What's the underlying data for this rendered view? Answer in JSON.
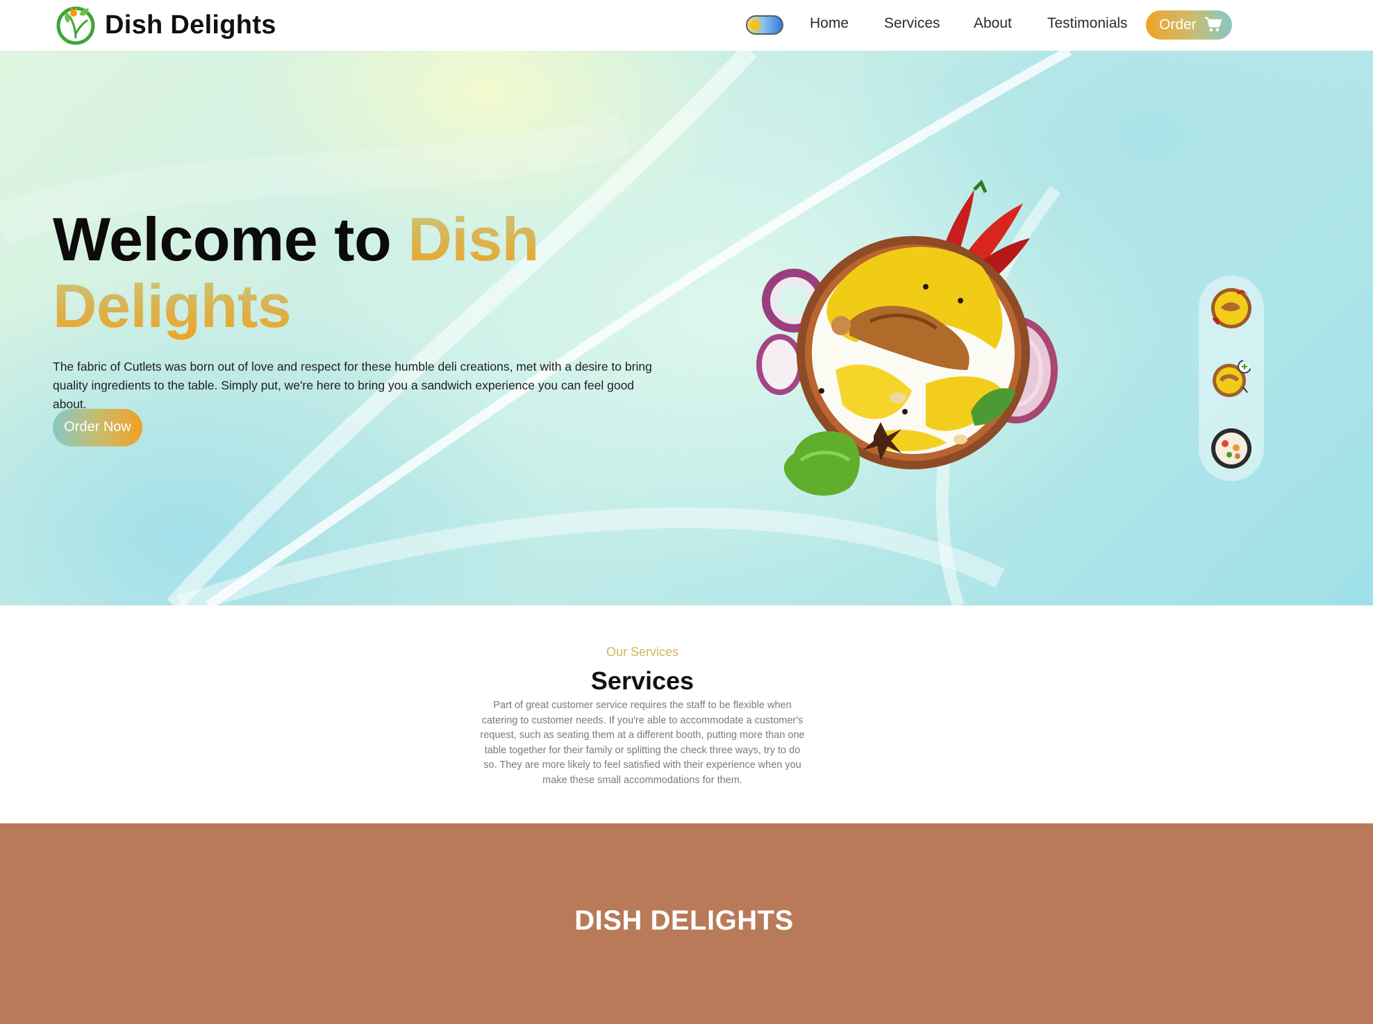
{
  "header": {
    "brand": "Dish Delights",
    "nav": [
      "Home",
      "Services",
      "About",
      "Testimonials"
    ],
    "order_label": "Order"
  },
  "hero": {
    "title_plain": "Welcome to ",
    "title_accent_line1": "Dish",
    "title_accent_line2": "Delights",
    "description": "The fabric of Cutlets was born out of love and respect for these humble deli creations, met with a desire to bring quality ingredients to the table. Simply put, we're here to bring you a sandwich experience you can feel good about.",
    "cta": "Order Now",
    "thumbnails": [
      "biryani-bowl-thumb",
      "biryani-plate-thumb",
      "rice-bowl-thumb"
    ]
  },
  "services": {
    "kicker": "Our Services",
    "title": "Services",
    "description": "Part of great customer service requires the staff to be flexible when catering to customer needs. If you're able to accommodate a customer's request, such as seating them at a different booth, putting more than one table together for their family or splitting the check three ways, try to do so. They are more likely to feel satisfied with their experience when you make these small accommodations for them."
  },
  "footer": {
    "title": "DISH DELIGHTS"
  },
  "colors": {
    "accent_orange": "#f2a024",
    "footer_brown": "#b87a58",
    "kicker_gold": "#d2b45a"
  }
}
